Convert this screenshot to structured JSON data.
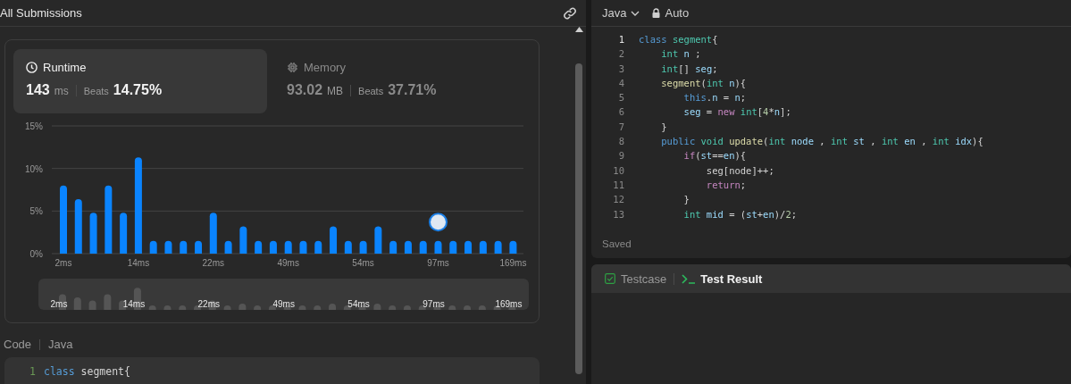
{
  "submissions": {
    "title": "All Submissions",
    "stats": [
      {
        "kind": "runtime",
        "label": "Runtime",
        "value": "143",
        "unit": "ms",
        "beats_label": "Beats",
        "beats": "14.75%",
        "selected": true
      },
      {
        "kind": "memory",
        "label": "Memory",
        "value": "93.02",
        "unit": "MB",
        "beats_label": "Beats",
        "beats": "37.71%",
        "selected": false
      }
    ],
    "chart_data": {
      "type": "bar",
      "categories": [
        "2ms",
        null,
        null,
        null,
        null,
        "14ms",
        null,
        null,
        null,
        null,
        "22ms",
        null,
        null,
        null,
        null,
        "49ms",
        null,
        null,
        null,
        null,
        "54ms",
        null,
        null,
        null,
        null,
        "97ms",
        null,
        null,
        null,
        null,
        "169ms"
      ],
      "series": [
        {
          "color": "#0a84ff",
          "values": [
            8,
            6.4,
            4.8,
            8,
            4.8,
            11.3,
            1.5,
            1.5,
            1.5,
            1.5,
            4.8,
            1.5,
            3.2,
            1.5,
            1.5,
            1.5,
            1.5,
            1.5,
            3.2,
            1.5,
            1.5,
            3.2,
            1.5,
            1.5,
            1.5,
            1.5,
            1.5,
            1.5,
            1.5,
            1.5,
            1.5
          ]
        }
      ],
      "ylim": [
        0,
        15
      ],
      "yticks": [
        {
          "value": 0,
          "label": "0%"
        },
        {
          "value": 5,
          "label": "5%"
        },
        {
          "value": 10,
          "label": "10%"
        },
        {
          "value": 15,
          "label": "15%"
        }
      ],
      "annotations": [
        {
          "x": "97ms"
        }
      ]
    },
    "navigator": {
      "labels": [
        "2ms",
        "14ms",
        "22ms",
        "49ms",
        "54ms",
        "97ms",
        "169ms"
      ]
    },
    "code_header": {
      "label": "Code",
      "language": "Java"
    },
    "code_preview": [
      {
        "number": "1",
        "tokens": [
          {
            "text": "class",
            "kind": "keyword"
          },
          {
            "text": " segment{",
            "kind": "plain"
          }
        ]
      }
    ]
  },
  "editor": {
    "language": "Java",
    "mode": "Auto",
    "status": "Saved",
    "lines": [
      {
        "number": "1",
        "tokens": [
          {
            "text": "class ",
            "kind": "keyword"
          },
          {
            "text": "segment",
            "kind": "type"
          },
          {
            "text": "{",
            "kind": "plain"
          }
        ]
      },
      {
        "number": "2",
        "tokens": [
          {
            "text": "    int ",
            "kind": "type"
          },
          {
            "text": "n",
            "kind": "variable"
          },
          {
            "text": " ;",
            "kind": "plain"
          }
        ]
      },
      {
        "number": "3",
        "tokens": [
          {
            "text": "    int",
            "kind": "type"
          },
          {
            "text": "[] ",
            "kind": "plain"
          },
          {
            "text": "seg",
            "kind": "variable"
          },
          {
            "text": ";",
            "kind": "plain"
          }
        ]
      },
      {
        "number": "4",
        "tokens": [
          {
            "text": "    segment",
            "kind": "function"
          },
          {
            "text": "(",
            "kind": "plain"
          },
          {
            "text": "int ",
            "kind": "type"
          },
          {
            "text": "n",
            "kind": "variable"
          },
          {
            "text": "){",
            "kind": "plain"
          }
        ]
      },
      {
        "number": "5",
        "tokens": [
          {
            "text": "        this",
            "kind": "keyword"
          },
          {
            "text": ".",
            "kind": "plain"
          },
          {
            "text": "n",
            "kind": "variable"
          },
          {
            "text": " = ",
            "kind": "plain"
          },
          {
            "text": "n",
            "kind": "variable"
          },
          {
            "text": ";",
            "kind": "plain"
          }
        ]
      },
      {
        "number": "6",
        "tokens": [
          {
            "text": "        seg",
            "kind": "variable"
          },
          {
            "text": " = ",
            "kind": "plain"
          },
          {
            "text": "new ",
            "kind": "control"
          },
          {
            "text": "int",
            "kind": "type"
          },
          {
            "text": "[",
            "kind": "plain"
          },
          {
            "text": "4",
            "kind": "number"
          },
          {
            "text": "*",
            "kind": "plain"
          },
          {
            "text": "n",
            "kind": "variable"
          },
          {
            "text": "];",
            "kind": "plain"
          }
        ]
      },
      {
        "number": "7",
        "tokens": [
          {
            "text": "    }",
            "kind": "plain"
          }
        ]
      },
      {
        "number": "8",
        "tokens": [
          {
            "text": "    public ",
            "kind": "keyword"
          },
          {
            "text": "void ",
            "kind": "type"
          },
          {
            "text": "update",
            "kind": "function"
          },
          {
            "text": "(",
            "kind": "plain"
          },
          {
            "text": "int ",
            "kind": "type"
          },
          {
            "text": "node",
            "kind": "variable"
          },
          {
            "text": " , ",
            "kind": "plain"
          },
          {
            "text": "int ",
            "kind": "type"
          },
          {
            "text": "st",
            "kind": "variable"
          },
          {
            "text": " , ",
            "kind": "plain"
          },
          {
            "text": "int ",
            "kind": "type"
          },
          {
            "text": "en",
            "kind": "variable"
          },
          {
            "text": " , ",
            "kind": "plain"
          },
          {
            "text": "int ",
            "kind": "type"
          },
          {
            "text": "idx",
            "kind": "variable"
          },
          {
            "text": "){",
            "kind": "plain"
          }
        ]
      },
      {
        "number": "9",
        "tokens": [
          {
            "text": "        if",
            "kind": "control"
          },
          {
            "text": "(",
            "kind": "plain"
          },
          {
            "text": "st",
            "kind": "variable"
          },
          {
            "text": "==",
            "kind": "plain"
          },
          {
            "text": "en",
            "kind": "variable"
          },
          {
            "text": "){",
            "kind": "plain"
          }
        ]
      },
      {
        "number": "10",
        "tokens": [
          {
            "text": "            seg[node]++;",
            "kind": "plain"
          }
        ]
      },
      {
        "number": "11",
        "tokens": [
          {
            "text": "            return",
            "kind": "control"
          },
          {
            "text": ";",
            "kind": "plain"
          }
        ]
      },
      {
        "number": "12",
        "tokens": [
          {
            "text": "        }",
            "kind": "plain"
          }
        ]
      },
      {
        "number": "13",
        "tokens": [
          {
            "text": "        int ",
            "kind": "type"
          },
          {
            "text": "mid",
            "kind": "variable"
          },
          {
            "text": " = (",
            "kind": "plain"
          },
          {
            "text": "st",
            "kind": "variable"
          },
          {
            "text": "+",
            "kind": "plain"
          },
          {
            "text": "en",
            "kind": "variable"
          },
          {
            "text": ")/",
            "kind": "plain"
          },
          {
            "text": "2",
            "kind": "number"
          },
          {
            "text": ";",
            "kind": "plain"
          }
        ]
      }
    ]
  },
  "result_panel": {
    "tabs": [
      {
        "kind": "testcase",
        "label": "Testcase",
        "selected": false
      },
      {
        "kind": "result",
        "label": "Test Result",
        "selected": true
      }
    ]
  }
}
